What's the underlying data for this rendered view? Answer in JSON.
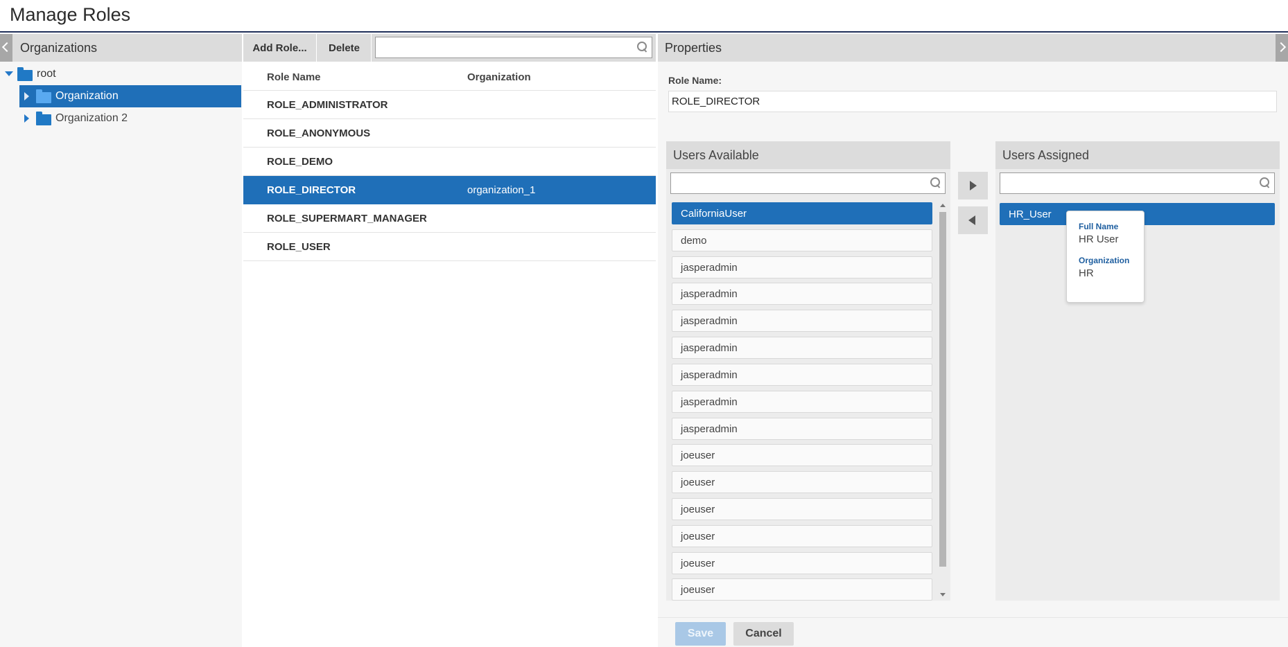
{
  "page": {
    "title": "Manage Roles"
  },
  "organizations": {
    "header": "Organizations",
    "tree": [
      {
        "label": "root"
      },
      {
        "label": "Organization"
      },
      {
        "label": "Organization 2"
      }
    ]
  },
  "roles": {
    "toolbar": {
      "add_label": "Add Role...",
      "delete_label": "Delete",
      "search_value": ""
    },
    "columns": {
      "name": "Role Name",
      "organization": "Organization"
    },
    "rows": [
      {
        "name": "ROLE_ADMINISTRATOR",
        "organization": ""
      },
      {
        "name": "ROLE_ANONYMOUS",
        "organization": ""
      },
      {
        "name": "ROLE_DEMO",
        "organization": ""
      },
      {
        "name": "ROLE_DIRECTOR",
        "organization": "organization_1"
      },
      {
        "name": "ROLE_SUPERMART_MANAGER",
        "organization": ""
      },
      {
        "name": "ROLE_USER",
        "organization": ""
      }
    ]
  },
  "properties": {
    "header": "Properties",
    "role_name_label": "Role Name:",
    "role_name_value": "ROLE_DIRECTOR",
    "users_available": {
      "header": "Users Available",
      "search_value": "",
      "items": [
        "CaliforniaUser",
        "demo",
        "jasperadmin",
        "jasperadmin",
        "jasperadmin",
        "jasperadmin",
        "jasperadmin",
        "jasperadmin",
        "jasperadmin",
        "joeuser",
        "joeuser",
        "joeuser",
        "joeuser",
        "joeuser",
        "joeuser"
      ]
    },
    "users_assigned": {
      "header": "Users Assigned",
      "search_value": "",
      "items": [
        "HR_User"
      ]
    },
    "tooltip": {
      "full_name_label": "Full Name",
      "full_name_value": "HR User",
      "organization_label": "Organization",
      "organization_value": "HR"
    },
    "footer": {
      "save_label": "Save",
      "cancel_label": "Cancel"
    }
  },
  "colors": {
    "selection": "#1f6fb8",
    "header_bar": "#1f2f5a",
    "panel_header": "#dcdcdc"
  }
}
